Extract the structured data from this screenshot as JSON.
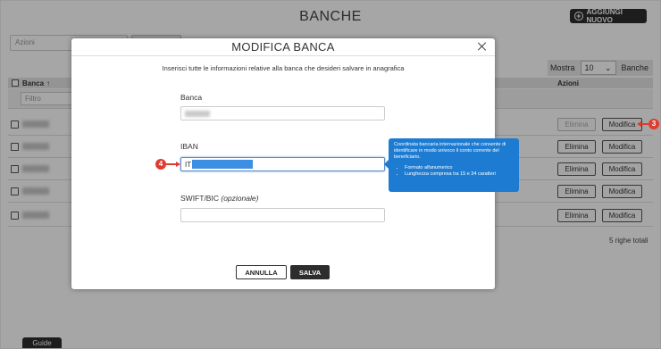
{
  "page": {
    "title": "BANCHE",
    "add_button": "AGGIUNGI NUOVO",
    "actions_placeholder": "Azioni",
    "show_label": "Mostra",
    "show_value": "10",
    "show_suffix": "Banche",
    "col_bank": "Banca",
    "sort_icon": "↑",
    "col_actions": "Azioni",
    "filter_placeholder": "Filtro",
    "rows": [
      {
        "delete": "Elimina",
        "edit": "Modifica"
      },
      {
        "delete": "Elimina",
        "edit": "Modifica"
      },
      {
        "delete": "Elimina",
        "edit": "Modifica"
      },
      {
        "delete": "Elimina",
        "edit": "Modifica"
      },
      {
        "delete": "Elimina",
        "edit": "Modifica"
      }
    ],
    "row_count": "5 righe totali",
    "guide_tab": "Guide"
  },
  "modal": {
    "title": "MODIFICA BANCA",
    "intro": "Inserisci tutte le informazioni relative alla banca che desideri salvare in anagrafica",
    "bank_label": "Banca",
    "iban_label": "IBAN",
    "iban_prefix": "IT",
    "swift_label": "SWIFT/BIC",
    "swift_optional": "(opzionale)",
    "cancel": "ANNULLA",
    "save": "SALVA"
  },
  "tooltip": {
    "text": "Coordinata bancaria internazionale che consente di identificare in modo univoco il conto corrente del beneficiario.",
    "items": [
      "Formato alfanumerico",
      "Lunghezza compresa tra 15 e 34 caratteri"
    ]
  },
  "markers": {
    "edit": "3",
    "iban": "4"
  },
  "colors": {
    "accent": "#1d7bd1",
    "marker": "#e03b2f",
    "dark": "#2d2d2d"
  }
}
